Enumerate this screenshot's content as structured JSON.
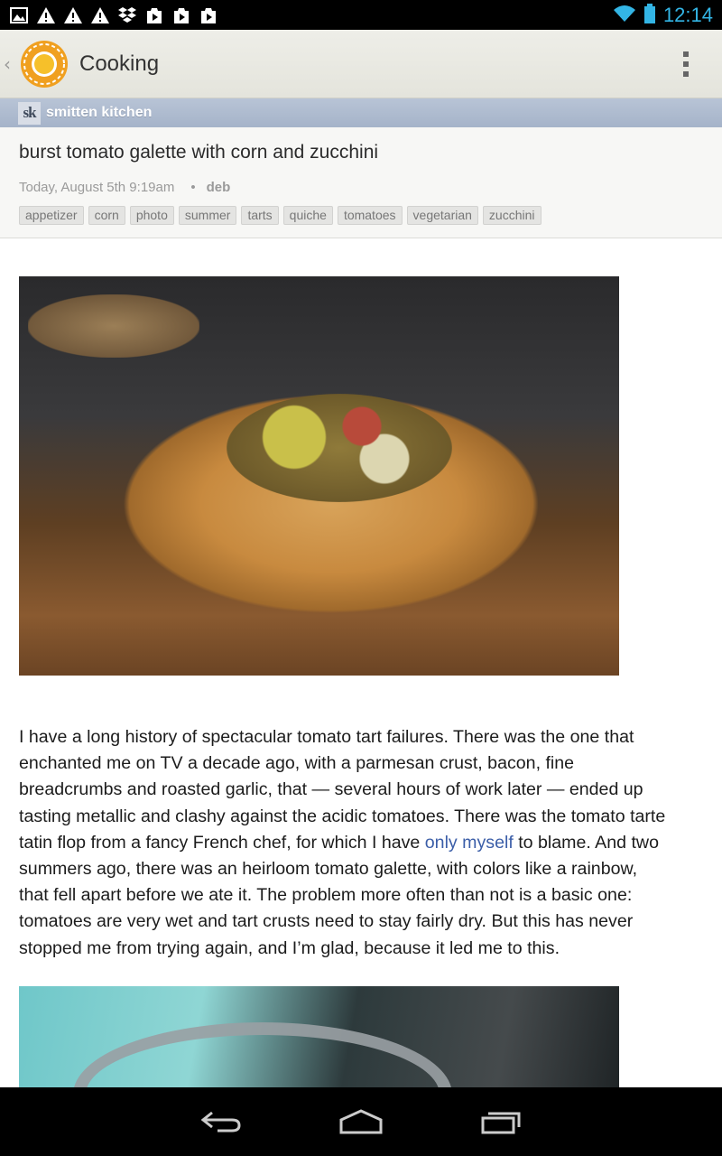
{
  "status_bar": {
    "time": "12:14",
    "accent_color": "#33b5e5",
    "left_icons": [
      "gallery-icon",
      "warning-icon",
      "warning-icon",
      "warning-icon",
      "dropbox-icon",
      "play-store-icon",
      "play-store-icon",
      "play-store-icon"
    ],
    "right_icons": [
      "wifi-icon",
      "battery-icon"
    ]
  },
  "action_bar": {
    "title": "Cooking",
    "logo_icon": "sun-logo-icon",
    "overflow_icon": "overflow-menu-icon"
  },
  "feed": {
    "logo_text": "sk",
    "name": "smitten kitchen"
  },
  "article": {
    "title": "burst tomato galette with corn and zucchini",
    "date": "Today, August 5th 9:19am",
    "separator": "•",
    "author": "deb",
    "tags": [
      "appetizer",
      "corn",
      "photo",
      "summer",
      "tarts",
      "quiche",
      "tomatoes",
      "vegetarian",
      "zucchini"
    ],
    "paragraph_before_link": "I have a long history of spectacular tomato tart failures. There was the one that enchanted me on TV a decade ago, with a parmesan crust, bacon, fine breadcrumbs and roasted garlic, that — several hours of work later — ended up tasting metallic and clashy against the acidic tomatoes. There was the tomato tarte tatin flop from a fancy French chef, for which I have ",
    "link_text": "only myself",
    "paragraph_after_link": " to blame. And two summers ago, there was an heirloom tomato galette, with colors like a rainbow, that fell apart before we ate it. The problem more often than not is a basic one: tomatoes are very wet and tart crusts need to stay fairly dry. But this has never stopped me from trying again, and I’m glad, because it led me to this.",
    "link_color": "#3b5ea8"
  },
  "nav_bar": {
    "icons": [
      "back-icon",
      "home-icon",
      "recent-apps-icon"
    ]
  }
}
